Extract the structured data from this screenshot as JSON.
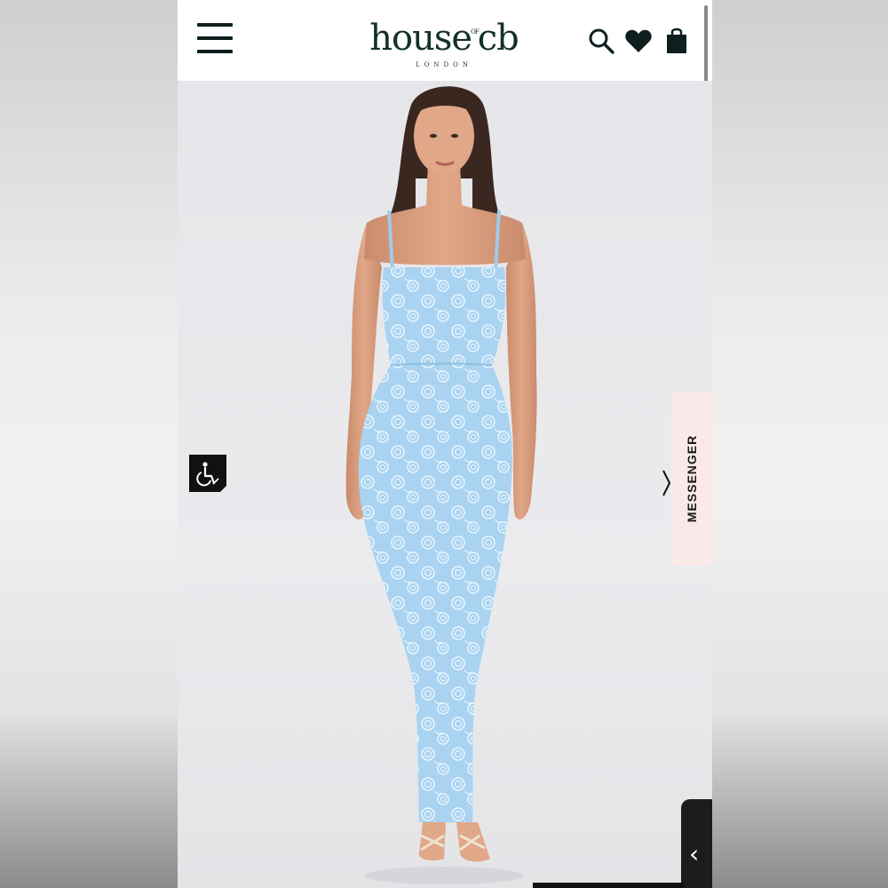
{
  "brand": {
    "name_part1": "house",
    "name_of": "OF",
    "name_part2": "cb",
    "location": "LONDON"
  },
  "header": {
    "icons": [
      "menu-icon",
      "search-icon",
      "heart-icon",
      "shopping-bag-icon"
    ]
  },
  "product_image": {
    "dress_color": "#a9d3f0"
  },
  "widgets": {
    "messenger_label": "MESSENGER",
    "accessibility_icon": "wheelchair-icon",
    "next_arrow_glyph": "›",
    "side_handle_glyph": "‹"
  },
  "colors": {
    "brand_green": "#123128",
    "messenger_bg": "#fbe9e9"
  }
}
